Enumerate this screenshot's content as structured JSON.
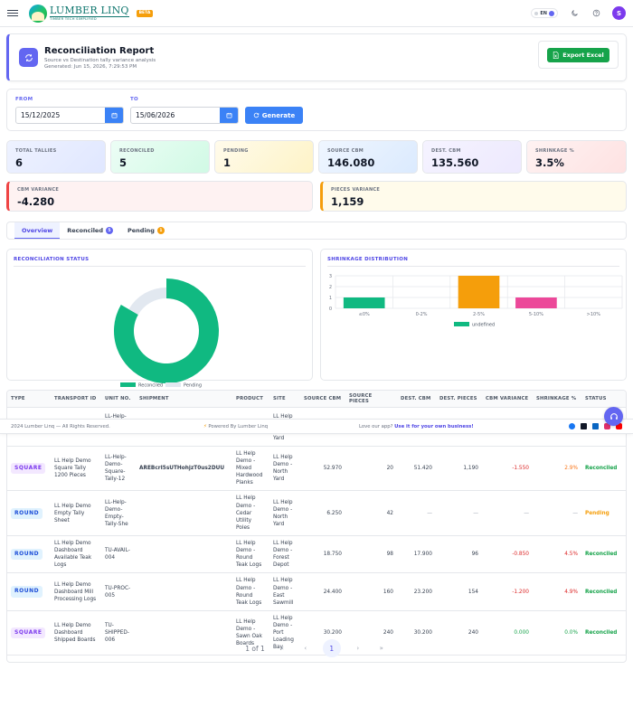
{
  "app": {
    "name": "LUMBER LINQ",
    "tagline": "TIMBER TECH SIMPLIFIED",
    "beta": "BETA",
    "lang": "EN",
    "user_initial": "S"
  },
  "header": {
    "title": "Reconciliation Report",
    "subtitle": "Source vs Destination tally variance analysis",
    "generated": "Generated: Jun 15, 2026, 7:29:53 PM",
    "export_label": "Export Excel"
  },
  "filters": {
    "from_label": "FROM",
    "from_value": "15/12/2025",
    "to_label": "TO",
    "to_value": "15/06/2026",
    "generate_label": "Generate"
  },
  "stats": [
    {
      "label": "TOTAL TALLIES",
      "value": "6"
    },
    {
      "label": "RECONCILED",
      "value": "5"
    },
    {
      "label": "PENDING",
      "value": "1"
    },
    {
      "label": "SOURCE CBM",
      "value": "146.080"
    },
    {
      "label": "DEST. CBM",
      "value": "135.560"
    },
    {
      "label": "SHRINKAGE %",
      "value": "3.5%"
    }
  ],
  "variance": {
    "cbm_label": "CBM VARIANCE",
    "cbm_value": "-4.280",
    "pieces_label": "PIECES VARIANCE",
    "pieces_value": "1,159"
  },
  "tabs": [
    {
      "label": "Overview"
    },
    {
      "label": "Reconciled",
      "count": "5"
    },
    {
      "label": "Pending",
      "count": "1"
    }
  ],
  "recon_status": {
    "title": "RECONCILIATION STATUS",
    "legend": [
      "Reconciled",
      "Pending"
    ],
    "colors": {
      "reconciled": "#10b981",
      "pending": "#e2e8f0"
    }
  },
  "chart_data": [
    {
      "type": "pie",
      "title": "RECONCILIATION STATUS",
      "categories": [
        "Reconciled",
        "Pending"
      ],
      "values": [
        5,
        1
      ],
      "legend": "bottom"
    },
    {
      "type": "bar",
      "title": "SHRINKAGE DISTRIBUTION",
      "categories": [
        "≤0%",
        "0-2%",
        "2-5%",
        "5-10%",
        ">10%"
      ],
      "values": [
        1,
        0,
        3,
        1,
        0
      ],
      "colors": [
        "#10b981",
        "#3b82f6",
        "#f59e0b",
        "#ec4899",
        "#ef4444"
      ],
      "ylim": [
        0,
        3
      ],
      "yticks": [
        "0",
        "1",
        "2",
        "3"
      ],
      "grid": true,
      "legend_label": "undefined",
      "legend": "bottom"
    }
  ],
  "shrinkage": {
    "title": "SHRINKAGE DISTRIBUTION",
    "legend_label": "undefined"
  },
  "table": {
    "columns": [
      "TYPE",
      "TRANSPORT ID",
      "UNIT NO.",
      "SHIPMENT",
      "PRODUCT",
      "SITE",
      "SOURCE CBM",
      "SOURCE PIECES",
      "DEST. CBM",
      "DEST. PIECES",
      "CBM VARIANCE",
      "SHRINKAGE %",
      "STATUS"
    ],
    "partial_row": {
      "unit": "LL-Help-\nDemo-\nTally-123",
      "site": "LL Help\nDemo -\nNorth\nYard"
    },
    "rows": [
      {
        "type": "SQUARE",
        "transport": "LL Help Demo Square Tally 1200 Pieces",
        "unit": "LL-Help-Demo-Square-Tally-12",
        "shipment": "AREBcrI5sUTHohjzT0us2DUU",
        "product": "LL Help Demo - Mixed Hardwood Planks",
        "site": "LL Help Demo - North Yard",
        "src_cbm": "52.970",
        "src_pcs": "20",
        "dst_cbm": "51.420",
        "dst_pcs": "1,190",
        "variance": "-1.550",
        "shrink": "2.9%",
        "status": "Reconciled"
      },
      {
        "type": "ROUND",
        "transport": "LL Help Demo Empty Tally Sheet",
        "unit": "LL-Help-Demo-Empty-Tally-She",
        "shipment": "",
        "product": "LL Help Demo - Cedar Utility Poles",
        "site": "LL Help Demo - North Yard",
        "src_cbm": "6.250",
        "src_pcs": "42",
        "dst_cbm": "—",
        "dst_pcs": "—",
        "variance": "—",
        "shrink": "—",
        "status": "Pending"
      },
      {
        "type": "ROUND",
        "transport": "LL Help Demo Dashboard Available Teak Logs",
        "unit": "TU-AVAIL-004",
        "shipment": "",
        "product": "LL Help Demo - Round Teak Logs",
        "site": "LL Help Demo - Forest Depot",
        "src_cbm": "18.750",
        "src_pcs": "98",
        "dst_cbm": "17.900",
        "dst_pcs": "96",
        "variance": "-0.850",
        "shrink": "4.5%",
        "status": "Reconciled"
      },
      {
        "type": "ROUND",
        "transport": "LL Help Demo Dashboard Mill Processing Logs",
        "unit": "TU-PROC-005",
        "shipment": "",
        "product": "LL Help Demo - Round Teak Logs",
        "site": "LL Help Demo - East Sawmill",
        "src_cbm": "24.400",
        "src_pcs": "160",
        "dst_cbm": "23.200",
        "dst_pcs": "154",
        "variance": "-1.200",
        "shrink": "4.9%",
        "status": "Reconciled"
      },
      {
        "type": "SQUARE",
        "transport": "LL Help Demo Dashboard Shipped Boards",
        "unit": "TU-SHIPPED-006",
        "shipment": "",
        "product": "LL Help Demo - Sawn Oak Boards",
        "site": "LL Help Demo - Port Loading Bay",
        "src_cbm": "30.200",
        "src_pcs": "240",
        "dst_cbm": "30.200",
        "dst_pcs": "240",
        "variance": "0.000",
        "shrink": "0.0%",
        "status": "Reconciled"
      }
    ]
  },
  "pagination": {
    "label": "1 of 1",
    "current": "1"
  },
  "footer": {
    "copyright": "2024 Lumber Linq — All Rights Reserved.",
    "powered": "Powered By Lumber Linq",
    "love": "Love our app?",
    "cta": "Use it for your own business!"
  }
}
